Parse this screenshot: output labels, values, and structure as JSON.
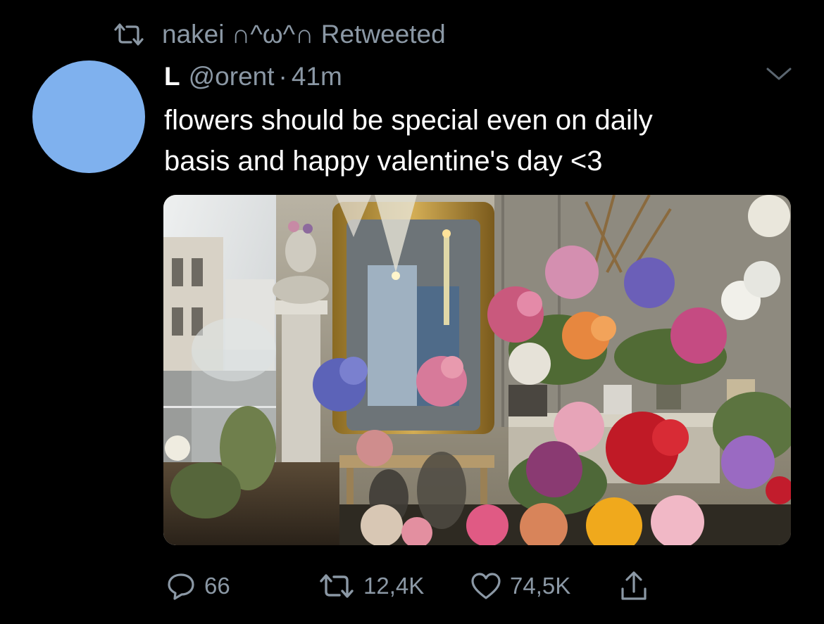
{
  "retweet": {
    "icon": "retweet-icon",
    "label": "nakei ∩^ω^∩ Retweeted"
  },
  "author": {
    "display_name": "L",
    "handle": "@orent",
    "separator": "·",
    "time": "41m",
    "avatar_color": "#7fb1ee"
  },
  "tweet": {
    "text_line1": "flowers should be special even on daily",
    "text_line2": "basis and happy valentine's day <3"
  },
  "media": {
    "type": "photo"
  },
  "actions": {
    "reply_count": "66",
    "retweet_count": "12,4K",
    "like_count": "74,5K",
    "icons": [
      "reply-icon",
      "retweet-icon",
      "like-icon",
      "share-icon"
    ]
  },
  "colors": {
    "background": "#000000",
    "secondary_text": "#8b98a5",
    "primary_text": "#ffffff"
  }
}
